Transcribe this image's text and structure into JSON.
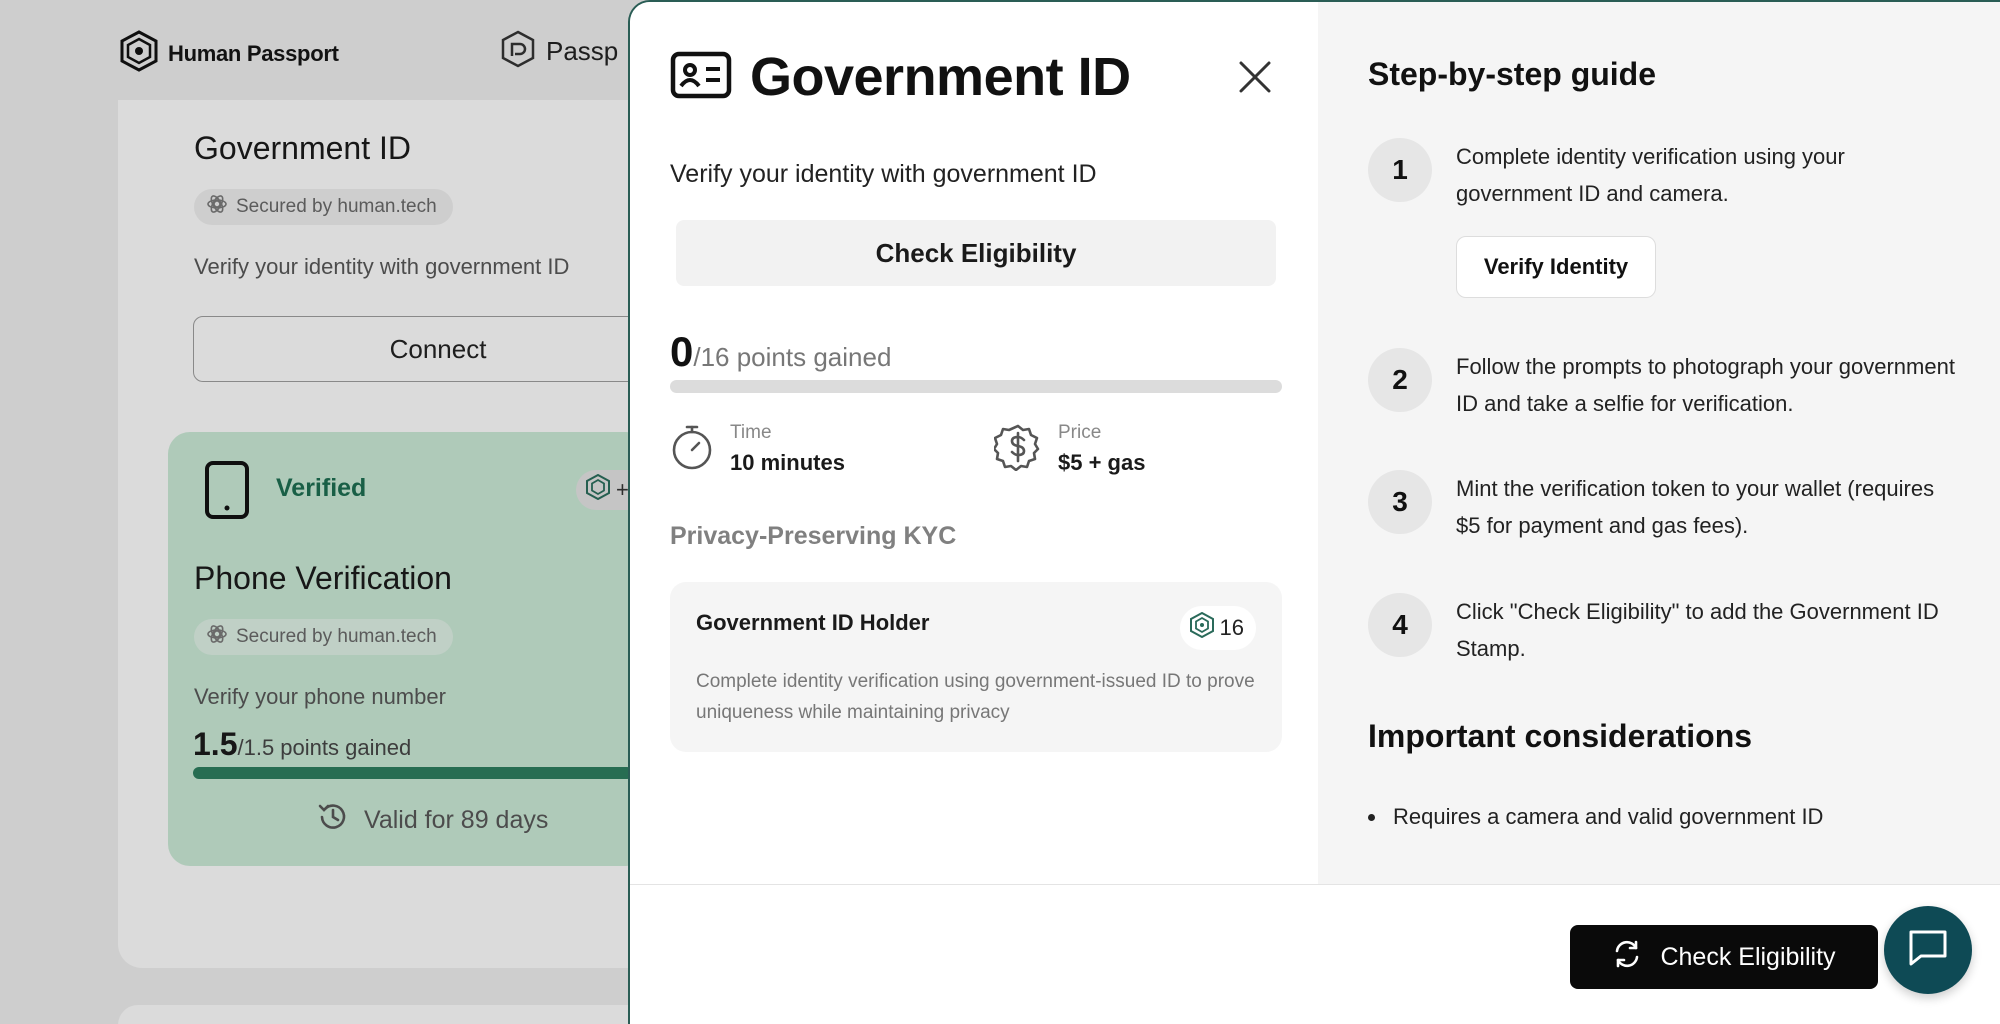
{
  "background": {
    "brand_name": "Human Passport",
    "brand_name_partial": "Passp",
    "gov_card": {
      "title": "Government ID",
      "secured": "Secured by human.tech",
      "description": "Verify your identity with government ID",
      "connect_label": "Connect"
    },
    "phone_card": {
      "status": "Verified",
      "badge_partial": "+",
      "title": "Phone Verification",
      "secured": "Secured by human.tech",
      "description": "Verify your phone number",
      "points_value": "1.5",
      "points_suffix": "/1.5 points gained",
      "progress_fraction": 1.0,
      "valid_text": "Valid for 89 days"
    }
  },
  "modal": {
    "title": "Government ID",
    "subtitle": "Verify your identity with government ID",
    "check_eligibility_label": "Check Eligibility",
    "points_value": "0",
    "points_suffix": "/16 points gained",
    "progress_fraction": 0,
    "time_label": "Time",
    "time_value": "10 minutes",
    "price_label": "Price",
    "price_value": "$5 + gas",
    "section_title": "Privacy-Preserving KYC",
    "holder": {
      "title": "Government ID Holder",
      "points": "16",
      "description": "Complete identity verification using government-issued ID to prove uniqueness while maintaining privacy"
    },
    "guide": {
      "title": "Step-by-step guide",
      "steps": [
        {
          "num": "1",
          "text": "Complete identity verification using your government ID and camera."
        },
        {
          "num": "2",
          "text": "Follow the prompts to photograph your government ID and take a selfie for verification."
        },
        {
          "num": "3",
          "text": "Mint the verification token to your wallet (requires $5 for payment and gas fees)."
        },
        {
          "num": "4",
          "text": "Click \"Check Eligibility\" to add the Government ID Stamp."
        }
      ],
      "verify_identity_label": "Verify Identity"
    },
    "considerations": {
      "title": "Important considerations",
      "items": [
        "Requires a camera and valid government ID"
      ]
    },
    "footer": {
      "check_eligibility_label": "Check Eligibility"
    }
  },
  "colors": {
    "accent_dark": "#0a0a0a",
    "verified_green": "#1c6a4e",
    "card_green": "#c3e1cf",
    "chat_teal": "#0e4a55"
  }
}
